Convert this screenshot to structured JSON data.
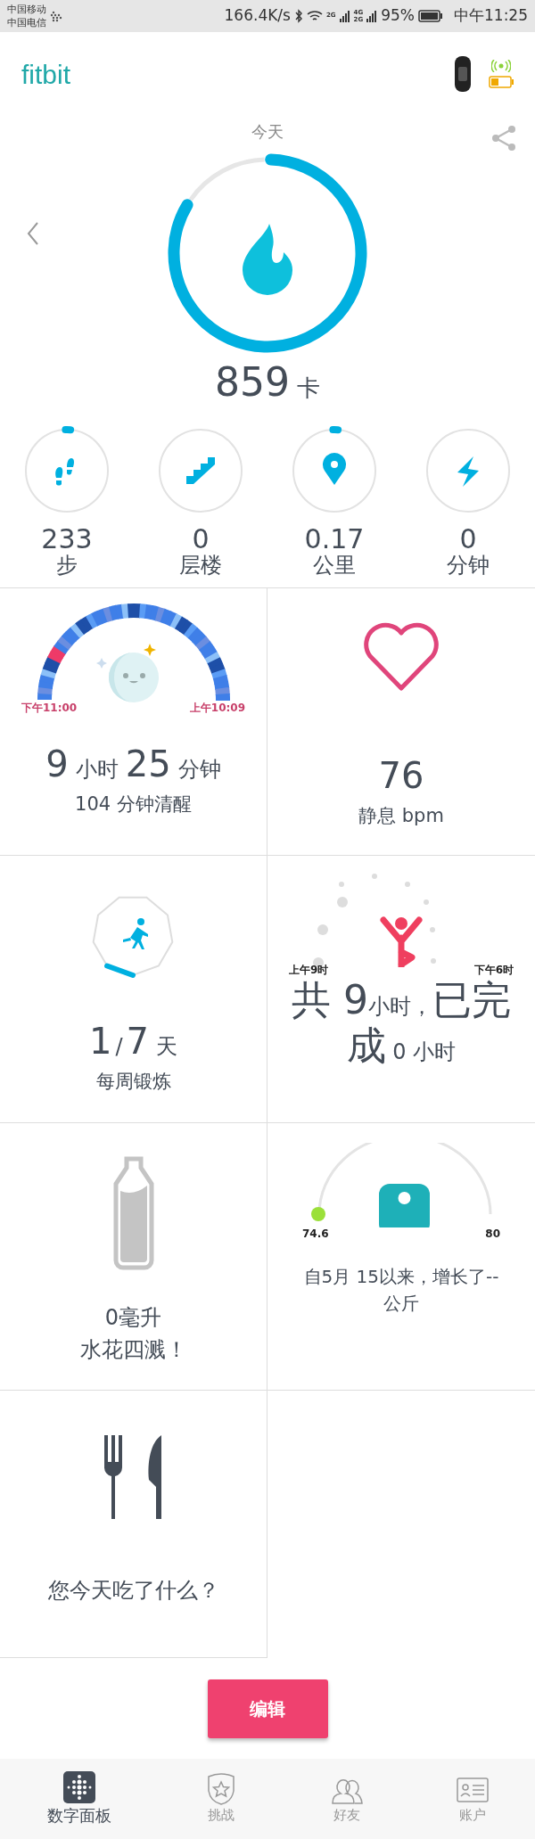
{
  "status_bar": {
    "carrier_1": "中国移动",
    "carrier_2": "中国电信",
    "speed": "166.4K/s",
    "signal_1": "2G",
    "signal_2_top": "4G",
    "signal_2_bottom": "2G",
    "battery": "95%",
    "time": "中午11:25"
  },
  "header": {
    "logo": "fitbit"
  },
  "summary": {
    "day": "今天",
    "value": "859",
    "unit": "卡",
    "level": 0.83
  },
  "stats": [
    {
      "kind": "steps",
      "value": "233",
      "unit": "步",
      "level": 0.02
    },
    {
      "kind": "floors",
      "value": "0",
      "unit": "层楼"
    },
    {
      "kind": "distance",
      "value": "0.17",
      "unit": "公里",
      "level": 0.02
    },
    {
      "kind": "active",
      "value": "0",
      "unit": "分钟"
    }
  ],
  "tiles": [
    {
      "kind": "sleep",
      "start": "下午11:00",
      "end": "上午10:09",
      "hours": "9",
      "hours_unit": "小时",
      "minutes": "25",
      "minutes_unit": "分钟",
      "note": "104 分钟清醒"
    },
    {
      "kind": "heart",
      "value": "76",
      "label": "静息 bpm"
    },
    {
      "kind": "exercise",
      "done": "1",
      "separator": "/",
      "total": "7",
      "unit": "天",
      "label": "每周锻炼"
    },
    {
      "kind": "hourly",
      "start": "上午9时",
      "end": "下午6时",
      "parts": [
        {
          "kind": "big",
          "text": "共 9"
        },
        {
          "kind": "small",
          "text": "小时，"
        },
        {
          "kind": "big",
          "text": "已完成"
        },
        {
          "kind": "small",
          "text": " 0 小时"
        }
      ]
    },
    {
      "kind": "water",
      "amount": "0毫升",
      "message": "水花四溅！"
    },
    {
      "kind": "weight",
      "start": "74.6",
      "goal": "80",
      "message": "自5月 15以来，增长了--公斤"
    },
    {
      "kind": "food",
      "question": "您今天吃了什么？"
    }
  ],
  "edit_button": "编辑",
  "nav": [
    {
      "label": "数字面板",
      "selected": true
    },
    {
      "label": "挑战",
      "selected": false
    },
    {
      "label": "好友",
      "selected": false
    },
    {
      "label": "账户",
      "selected": false
    }
  ]
}
